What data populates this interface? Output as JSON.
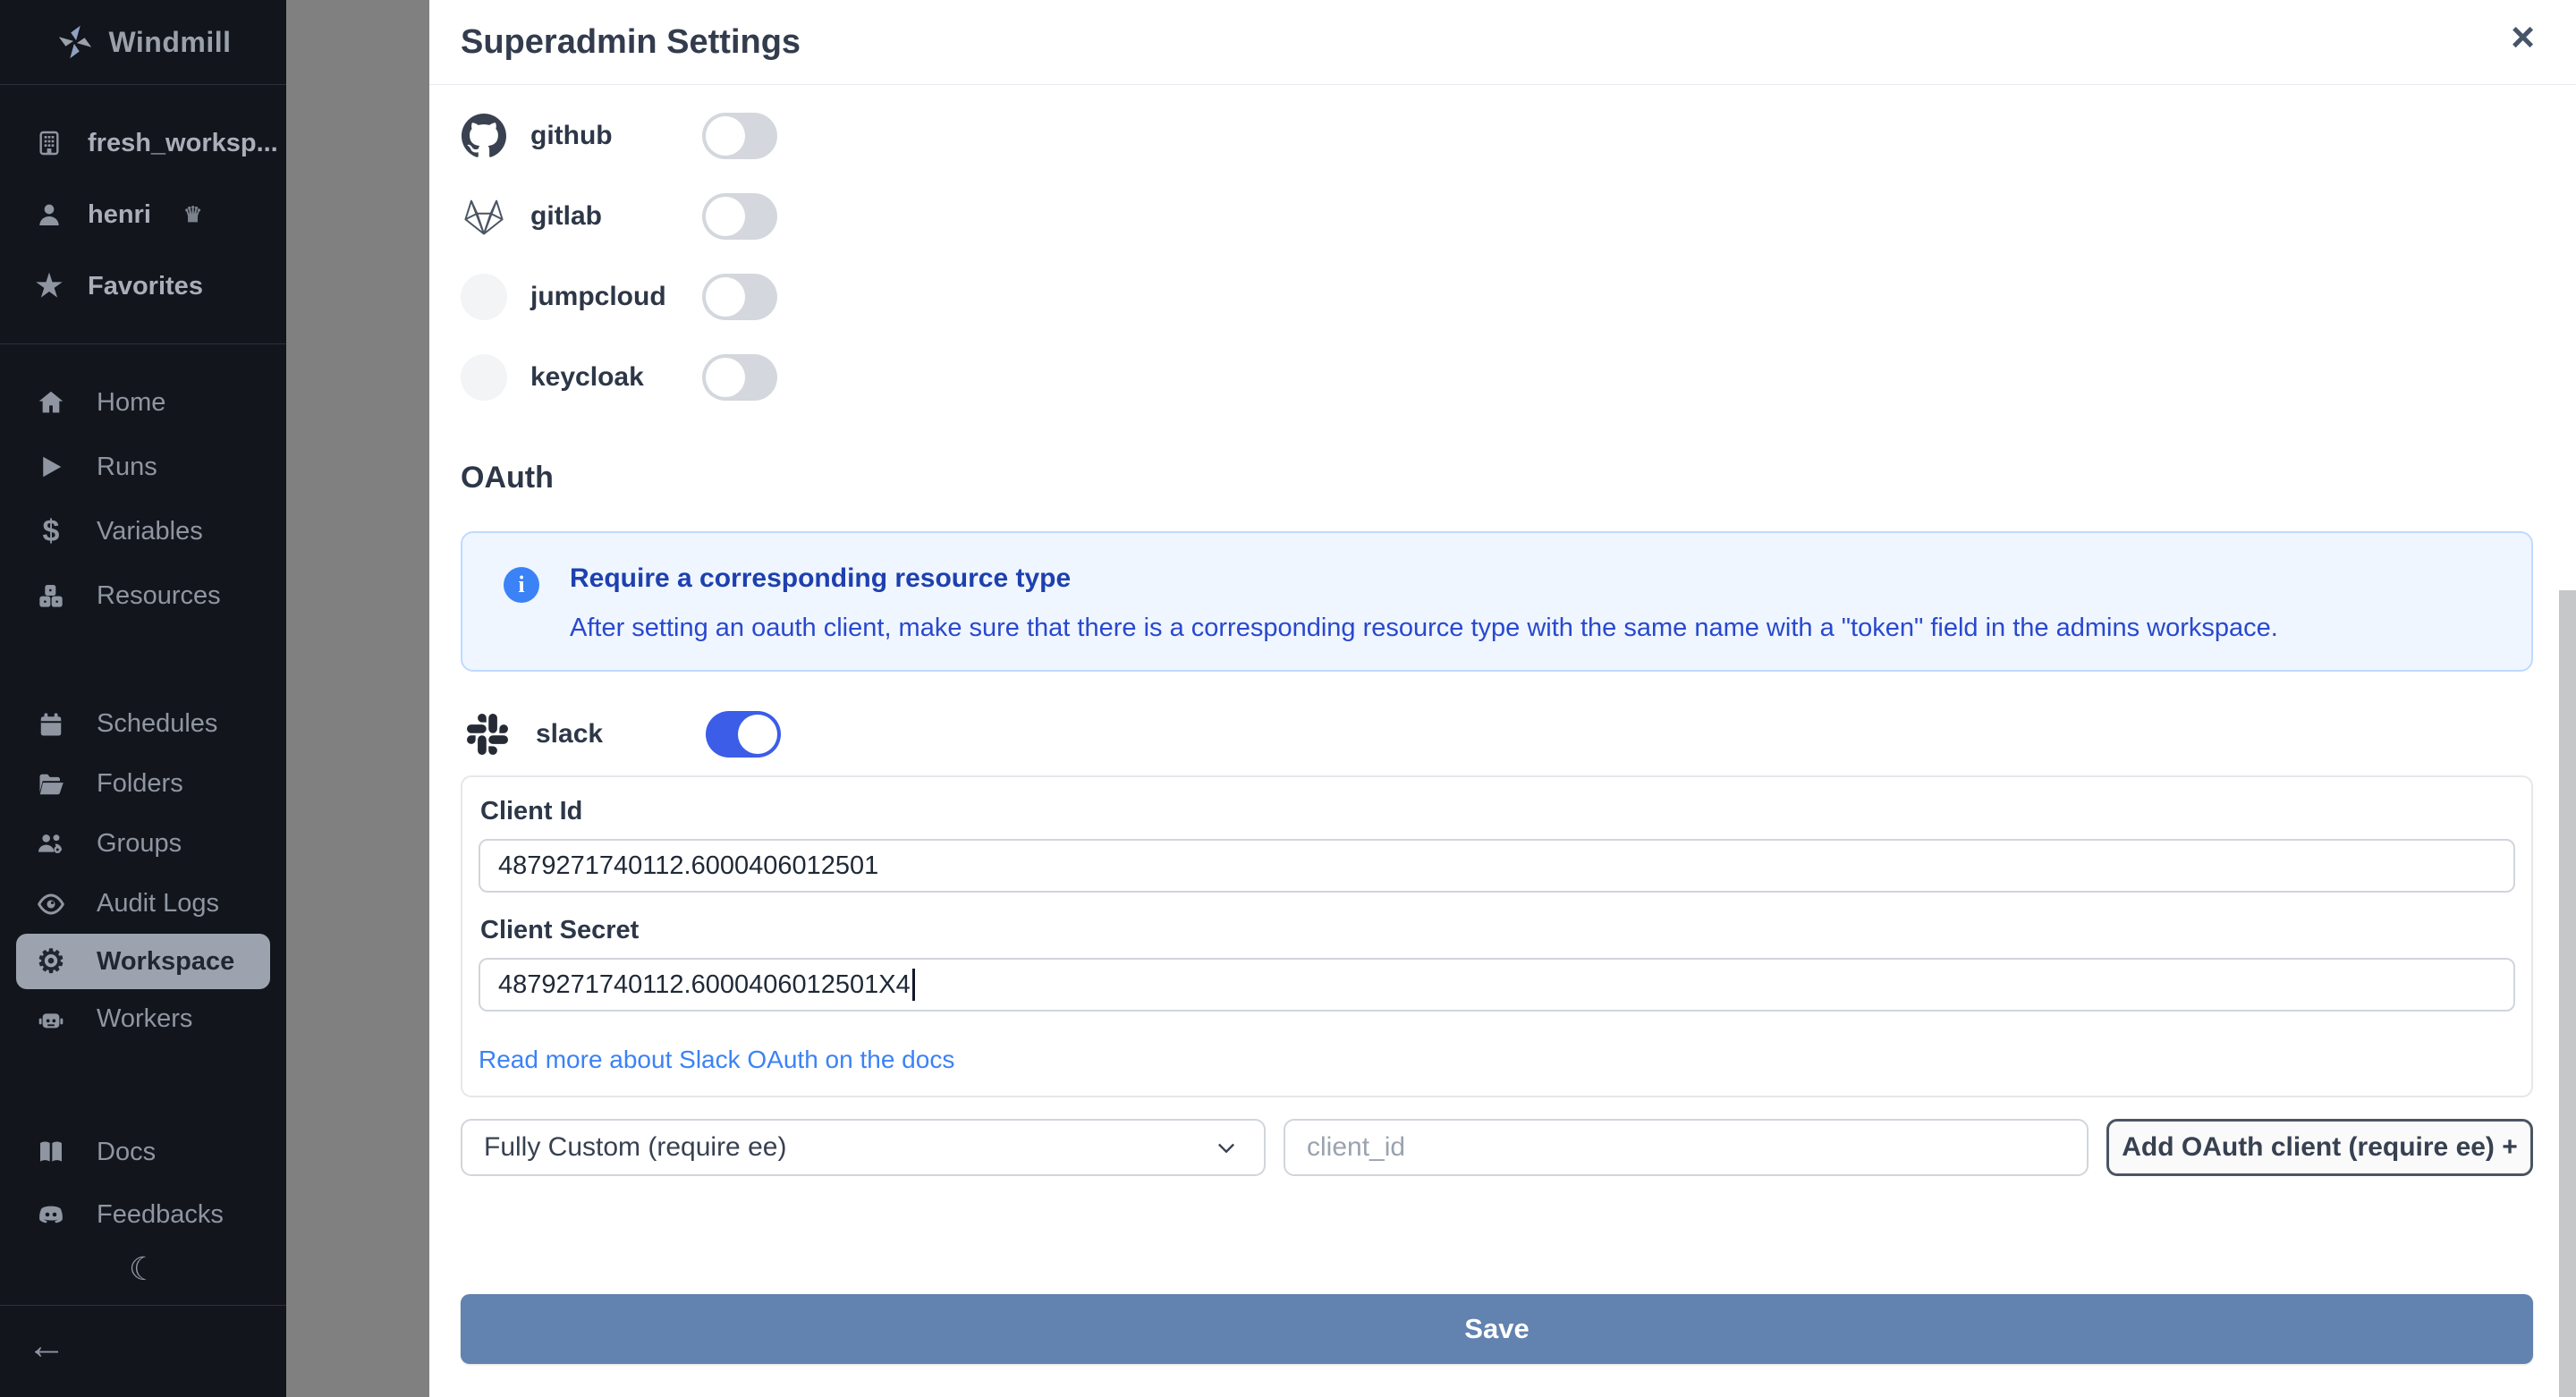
{
  "icons": {
    "star": "★",
    "crown": "♛",
    "dollar": "$",
    "gear": "⚙",
    "moon": "☾",
    "back_arrow": "←",
    "close": "×",
    "info": "i"
  },
  "colors": {
    "sidebar_bg": "#12151c",
    "accent_toggle_on": "#3b5de8",
    "save_blue": "#6282b0",
    "info_bg": "#eff6ff",
    "info_text": "#2948cf",
    "link_blue": "#3b82f6",
    "active_item_bg": "#9ca3af"
  },
  "sidebar": {
    "logo_text": "Windmill",
    "workspace_label": "fresh_worksp...",
    "user_label": "henri",
    "favorites_label": "Favorites",
    "nav_main": [
      {
        "label": "Home"
      },
      {
        "label": "Runs"
      },
      {
        "label": "Variables"
      },
      {
        "label": "Resources"
      }
    ],
    "nav_admin": [
      {
        "label": "Schedules"
      },
      {
        "label": "Folders"
      },
      {
        "label": "Groups"
      },
      {
        "label": "Audit Logs"
      },
      {
        "label": "Workspace",
        "active": true
      },
      {
        "label": "Workers"
      }
    ],
    "nav_footer": [
      {
        "label": "Docs"
      },
      {
        "label": "Feedbacks"
      }
    ]
  },
  "modal": {
    "title": "Superadmin Settings",
    "providers": [
      {
        "name": "github",
        "enabled": false
      },
      {
        "name": "gitlab",
        "enabled": false
      },
      {
        "name": "jumpcloud",
        "enabled": false
      },
      {
        "name": "keycloak",
        "enabled": false
      }
    ],
    "oauth": {
      "heading": "OAuth",
      "info_title": "Require a corresponding resource type",
      "info_body": "After setting an oauth client, make sure that there is a corresponding resource type with the same name with a \"token\" field in the admins workspace.",
      "slack": {
        "name": "slack",
        "enabled": true,
        "client_id_label": "Client Id",
        "client_id_value": "4879271740112.6000406012501",
        "client_secret_label": "Client Secret",
        "client_secret_value": "4879271740112.6000406012501X4",
        "docs_link": "Read more about Slack OAuth on the docs"
      },
      "custom": {
        "select_value": "Fully Custom (require ee)",
        "input_placeholder": "client_id",
        "add_button_label": "Add OAuth client (require ee) +"
      }
    },
    "save_label": "Save"
  }
}
